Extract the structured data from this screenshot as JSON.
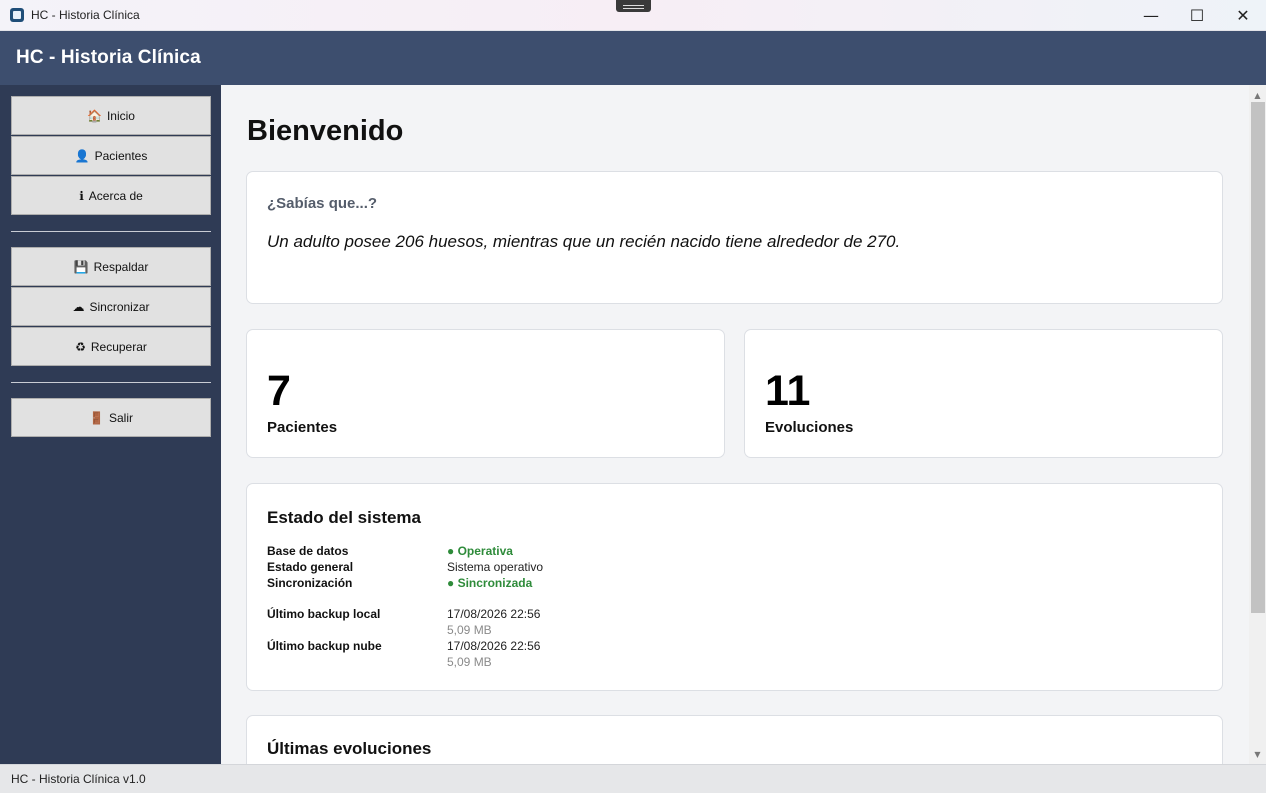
{
  "window": {
    "title": "HC - Historia Clínica",
    "minimize": "—",
    "maximize": "☐",
    "close": "✕"
  },
  "header": {
    "title": "HC - Historia Clínica"
  },
  "sidebar": {
    "items": [
      {
        "label": "Inicio",
        "icon": "🏠"
      },
      {
        "label": "Pacientes",
        "icon": "👤"
      },
      {
        "label": "Acerca de",
        "icon": "ℹ"
      },
      {
        "label": "Respaldar",
        "icon": "💾"
      },
      {
        "label": "Sincronizar",
        "icon": "☁"
      },
      {
        "label": "Recuperar",
        "icon": "♻"
      },
      {
        "label": "Salir",
        "icon": "🚪"
      }
    ]
  },
  "main": {
    "page_title": "Bienvenido",
    "tip": {
      "heading": "¿Sabías que...?",
      "text": "Un adulto posee 206 huesos, mientras que un recién nacido tiene alrededor de 270."
    },
    "stats": [
      {
        "value": "7",
        "label": "Pacientes"
      },
      {
        "value": "11",
        "label": "Evoluciones"
      }
    ],
    "system": {
      "title": "Estado del sistema",
      "rows": [
        {
          "label": "Base de datos",
          "value": "● Operativa"
        },
        {
          "label": "Estado general",
          "value": "Sistema operativo"
        },
        {
          "label": "Sincronización",
          "value": "● Sincronizada"
        }
      ],
      "backups": [
        {
          "label": "Último backup local",
          "date": "17/08/2026 22:56",
          "size": "5,09 MB"
        },
        {
          "label": "Último backup nube",
          "date": "17/08/2026 22:56",
          "size": "5,09 MB"
        }
      ]
    },
    "evolutions": {
      "title": "Últimas evoluciones"
    }
  },
  "scrollbar": {
    "up": "▲",
    "down": "▼"
  },
  "statusbar": {
    "text": "HC - Historia Clínica v1.0"
  },
  "colors": {
    "header_bg": "#3d4e6e",
    "sidebar_bg": "#2f3b55",
    "status_ok": "#2e8b3a"
  }
}
